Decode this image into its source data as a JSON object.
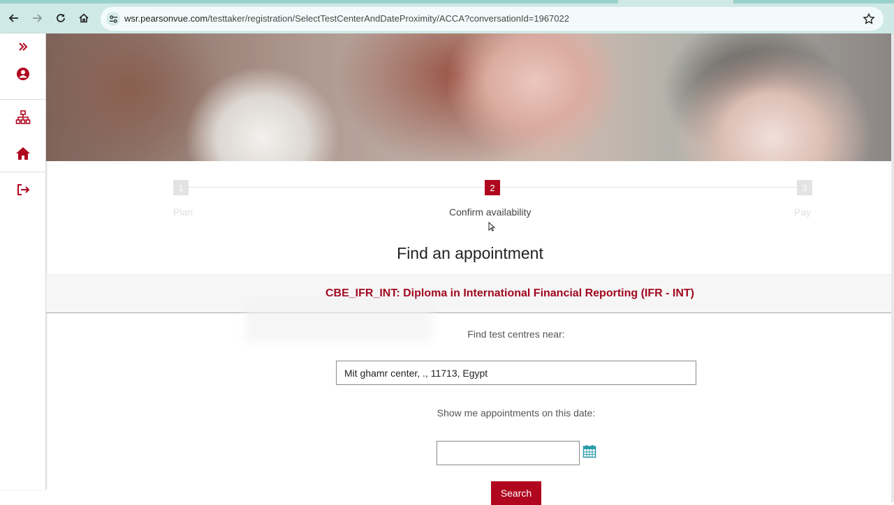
{
  "browser": {
    "url_host": "wsr.pearsonvue.com",
    "url_path": "/testtaker/registration/SelectTestCenterAndDateProximity/ACCA?conversationId=1967022",
    "icons": [
      "back-icon",
      "forward-icon",
      "reload-icon",
      "home-icon",
      "site-info-icon",
      "bookmark-star-icon"
    ]
  },
  "sidebar": {
    "icons": [
      "expand-chevrons-icon",
      "account-icon",
      "sitemap-icon",
      "home-icon",
      "sign-out-icon"
    ],
    "accent": "#b0071f"
  },
  "stepper": {
    "steps": [
      {
        "number": "1",
        "label": "Plan",
        "active": false
      },
      {
        "number": "2",
        "label": "Confirm availability",
        "active": true
      },
      {
        "number": "3",
        "label": "Pay",
        "active": false
      }
    ]
  },
  "main": {
    "title": "Find an appointment",
    "exam": "CBE_IFR_INT: Diploma in International Financial Reporting (IFR - INT)",
    "location_label": "Find test centres near:",
    "location_value": "Mit ghamr center, ., 11713, Egypt",
    "date_label": "Show me appointments on this date:",
    "date_value": "",
    "search_button": "Search"
  },
  "colors": {
    "brand_red": "#b0071f",
    "browser_bar": "#cfe9e6",
    "calendar_icon": "#2a9ba9"
  }
}
